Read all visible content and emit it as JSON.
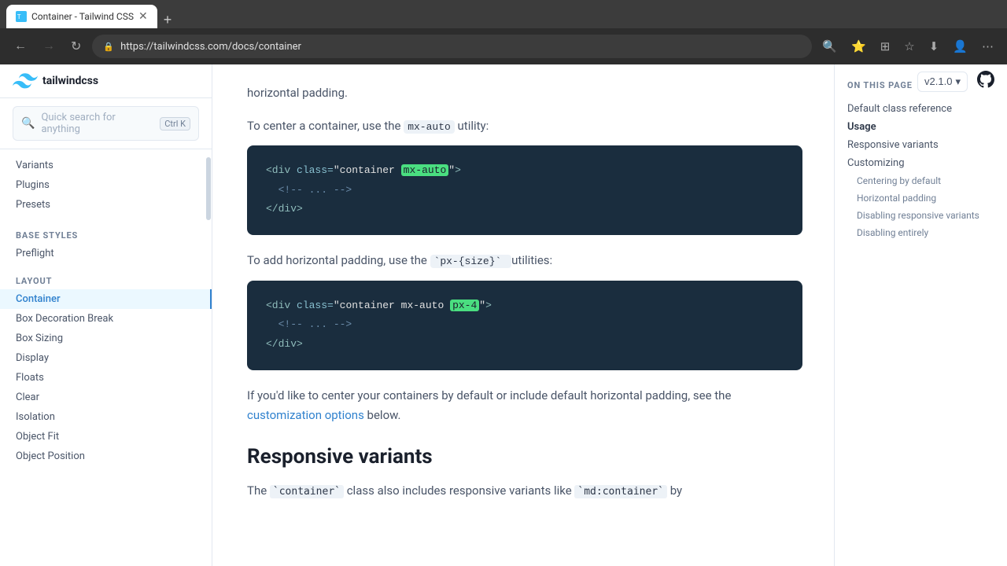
{
  "browser": {
    "tab_title": "Container - Tailwind CSS",
    "url": "https://tailwindcss.com/docs/container",
    "new_tab_label": "+",
    "nav": {
      "back": "←",
      "forward": "→",
      "refresh": "↻"
    },
    "toolbar_icons": [
      "⭐",
      "🔖",
      "⬇",
      "👤",
      "⋯"
    ]
  },
  "header": {
    "logo_text": "tailwindcss",
    "search_placeholder": "Quick search for anything",
    "search_shortcut": "Ctrl K",
    "version": "v2.1.0",
    "version_arrow": "▾"
  },
  "sidebar": {
    "sections": [
      {
        "label": "",
        "items": [
          {
            "id": "variants",
            "label": "Variants",
            "active": false
          },
          {
            "id": "plugins",
            "label": "Plugins",
            "active": false
          },
          {
            "id": "presets",
            "label": "Presets",
            "active": false
          }
        ]
      },
      {
        "label": "Base Styles",
        "items": [
          {
            "id": "preflight",
            "label": "Preflight",
            "active": false
          }
        ]
      },
      {
        "label": "Layout",
        "items": [
          {
            "id": "container",
            "label": "Container",
            "active": true
          },
          {
            "id": "box-decoration-break",
            "label": "Box Decoration Break",
            "active": false
          },
          {
            "id": "box-sizing",
            "label": "Box Sizing",
            "active": false
          },
          {
            "id": "display",
            "label": "Display",
            "active": false
          },
          {
            "id": "floats",
            "label": "Floats",
            "active": false
          },
          {
            "id": "clear",
            "label": "Clear",
            "active": false
          },
          {
            "id": "isolation",
            "label": "Isolation",
            "active": false
          },
          {
            "id": "object-fit",
            "label": "Object Fit",
            "active": false
          },
          {
            "id": "object-position",
            "label": "Object Position",
            "active": false
          }
        ]
      }
    ]
  },
  "main": {
    "intro_text": "horizontal padding.",
    "para1": "To center a container, use the",
    "para1_code": "mx-auto",
    "para1_suffix": "utility:",
    "code_block1": {
      "line1": "<div class=\"container mx-auto\">",
      "line2": "  <!-- ... -->",
      "line3": "</div>",
      "highlight": "mx-auto"
    },
    "para2": "To add horizontal padding, use the",
    "para2_code": "px-{size}",
    "para2_suffix": "utilities:",
    "code_block2": {
      "line1_pre": "<div class=\"container mx-auto ",
      "line1_hl": "px-4",
      "line1_post": "\">",
      "line2": "  <!-- ... -->",
      "line3": "</div>"
    },
    "para3_pre": "If you'd like to center your containers by default or include default horizontal padding, see the",
    "para3_link": "customization options",
    "para3_post": "below.",
    "section_heading": "Responsive variants",
    "section_sub": "The `container` class also includes responsive variants like `md:container` by"
  },
  "toc": {
    "heading": "ON THIS PAGE",
    "items": [
      {
        "id": "default-class-reference",
        "label": "Default class reference",
        "sub": false,
        "active": false
      },
      {
        "id": "usage",
        "label": "Usage",
        "sub": false,
        "active": true
      },
      {
        "id": "responsive-variants",
        "label": "Responsive variants",
        "sub": false,
        "active": false
      },
      {
        "id": "customizing",
        "label": "Customizing",
        "sub": false,
        "active": false
      },
      {
        "id": "centering-by-default",
        "label": "Centering by default",
        "sub": true,
        "active": false
      },
      {
        "id": "horizontal-padding",
        "label": "Horizontal padding",
        "sub": true,
        "active": false
      },
      {
        "id": "disabling-responsive-variants",
        "label": "Disabling responsive variants",
        "sub": true,
        "active": false
      },
      {
        "id": "disabling-entirely",
        "label": "Disabling entirely",
        "sub": true,
        "active": false
      }
    ]
  }
}
